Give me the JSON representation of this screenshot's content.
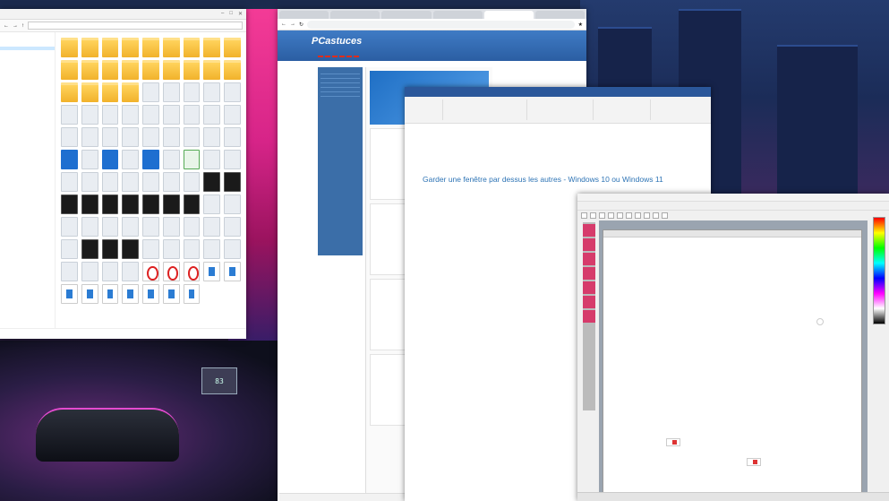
{
  "explorer": {
    "title": "",
    "address": "",
    "nav_items": [
      "",
      "",
      "",
      "",
      "",
      ""
    ],
    "status": ""
  },
  "browser": {
    "tabs": [
      "",
      "",
      "",
      "",
      "",
      ""
    ],
    "url": "",
    "logo": "PCastuces",
    "menu": [
      "",
      "",
      "",
      "",
      "",
      ""
    ],
    "status": ""
  },
  "word": {
    "ribbon_tabs": [
      "",
      "",
      "",
      "",
      "",
      "",
      "",
      ""
    ],
    "doc_title": "Garder une fenêtre par dessus les autres - Windows 10 ou Windows 11",
    "doc_text": ""
  },
  "paint": {
    "title": "",
    "menu": [
      "",
      "",
      "",
      "",
      "",
      "",
      "",
      ""
    ],
    "canvas_title": "",
    "badge1": "",
    "badge2": ""
  },
  "wallpaper": {
    "robot_label": "83"
  }
}
